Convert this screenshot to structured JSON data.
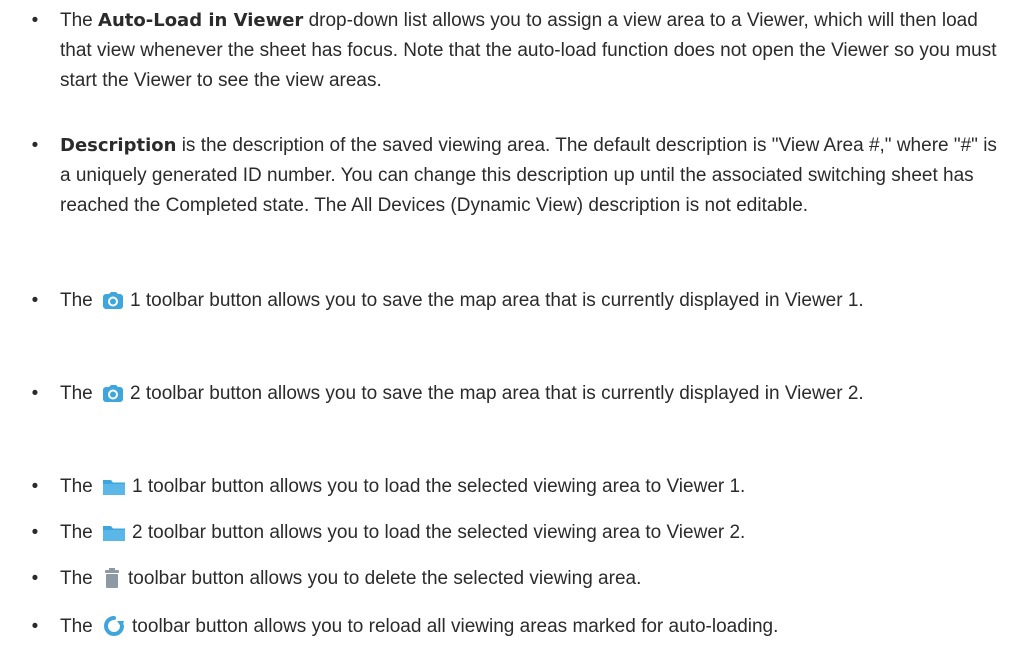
{
  "bullet": "•",
  "items": [
    {
      "bold": "Auto-Load in Viewer",
      "pre": "The ",
      "post": " drop-down list allows you to assign a view area to a Viewer, which will then load that view whenever the sheet has focus. Note that the auto-load function does not open the Viewer so you must start the Viewer to see the view areas."
    },
    {
      "bold": "Description",
      "post": " is the description of the saved viewing area. The default description is \"View Area #,\" where \"#\" is a uniquely generated ID number. You can change this description up until the associated switching sheet has reached the Completed state. The All Devices (Dynamic View) description is not editable."
    },
    {
      "pre": "The ",
      "icon": "camera-icon",
      "post": "1 toolbar button allows you to save the map area that is currently displayed in Viewer 1."
    },
    {
      "pre": "The ",
      "icon": "camera-icon",
      "post": "2 toolbar button allows you to save the map area that is currently displayed in Viewer 2."
    },
    {
      "pre": "The ",
      "icon": "folder-icon",
      "post": "1 toolbar button allows you to load the selected viewing area to Viewer 1."
    },
    {
      "pre": "The ",
      "icon": "folder-icon",
      "post": "2 toolbar button allows you to load the selected viewing area to Viewer 2."
    },
    {
      "pre": "The ",
      "icon": "trash-icon",
      "post": "toolbar button allows you to delete the selected viewing area."
    },
    {
      "pre": "The ",
      "icon": "refresh-icon",
      "post": "toolbar button allows you to reload all viewing areas marked for auto-loading."
    }
  ],
  "colors": {
    "text": "#2b2b2b",
    "icon_blue": "#3fa6dd",
    "icon_gray": "#8e9aa3"
  }
}
